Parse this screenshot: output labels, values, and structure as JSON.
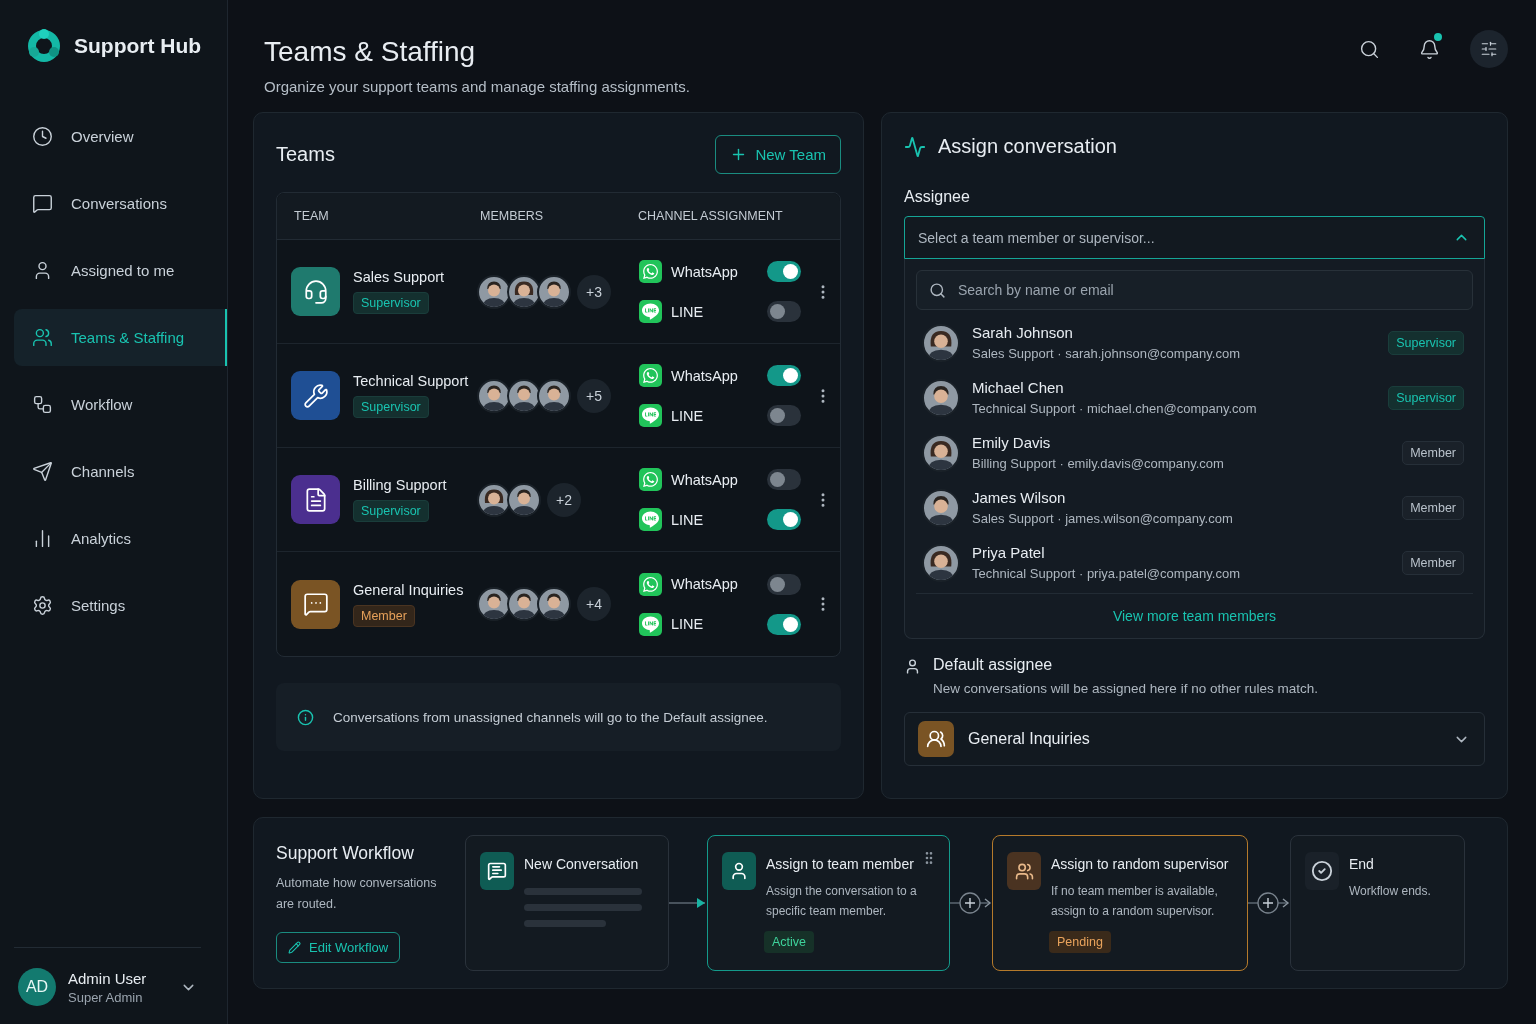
{
  "sidebar": {
    "brand": "Support Hub",
    "nav": [
      {
        "label": "Overview",
        "selected": false
      },
      {
        "label": "Conversations",
        "selected": false
      },
      {
        "label": "Assigned to me",
        "selected": false
      },
      {
        "label": "Teams & Staffing",
        "selected": true
      },
      {
        "label": "Workflow",
        "selected": false
      },
      {
        "label": "Channels",
        "selected": false
      },
      {
        "label": "Analytics",
        "selected": false
      },
      {
        "label": "Settings",
        "selected": false
      }
    ],
    "user": {
      "initials": "AD",
      "name": "Admin User",
      "role": "Super Admin"
    }
  },
  "header": {
    "title": "Teams & Staffing",
    "subtitle": "Organize your support teams and manage staffing assignments.",
    "unread": true
  },
  "teams": {
    "title": "Teams",
    "new_button": "New Team",
    "columns": [
      "TEAM",
      "MEMBERS",
      "CHANNEL ASSIGNMENT"
    ],
    "rows": [
      {
        "name": "Sales Support",
        "role": "Supervisor",
        "kind": "supervisor",
        "color": "#1f7a6e",
        "extra": "+3",
        "channels": [
          {
            "name": "WhatsApp",
            "kind": "whatsapp",
            "on": true
          },
          {
            "name": "LINE",
            "kind": "line",
            "on": false
          }
        ]
      },
      {
        "name": "Technical Support",
        "role": "Supervisor",
        "kind": "supervisor",
        "color": "#1f4f94",
        "extra": "+5",
        "channels": [
          {
            "name": "WhatsApp",
            "kind": "whatsapp",
            "on": true
          },
          {
            "name": "LINE",
            "kind": "line",
            "on": false
          }
        ]
      },
      {
        "name": "Billing Support",
        "role": "Supervisor",
        "kind": "supervisor",
        "color": "#4b2f8f",
        "extra": "+2",
        "channels": [
          {
            "name": "WhatsApp",
            "kind": "whatsapp",
            "on": false
          },
          {
            "name": "LINE",
            "kind": "line",
            "on": true
          }
        ]
      },
      {
        "name": "General Inquiries",
        "role": "Member",
        "kind": "member",
        "color": "#7a5424",
        "extra": "+4",
        "channels": [
          {
            "name": "WhatsApp",
            "kind": "whatsapp",
            "on": false
          },
          {
            "name": "LINE",
            "kind": "line",
            "on": true
          }
        ]
      }
    ],
    "note": "Conversations from unassigned channels will go to the Default assignee."
  },
  "assign": {
    "title": "Assign conversation",
    "label": "Assignee",
    "placeholder": "Select a team member or supervisor...",
    "expanded": true,
    "search_placeholder": "Search by name or email",
    "people": [
      {
        "name": "Sarah Johnson",
        "detail": "Sales Support · sarah.johnson@company.com",
        "role": "Supervisor",
        "kind": "supervisor"
      },
      {
        "name": "Michael Chen",
        "detail": "Technical Support · michael.chen@company.com",
        "role": "Supervisor",
        "kind": "supervisor"
      },
      {
        "name": "Emily Davis",
        "detail": "Billing Support · emily.davis@company.com",
        "role": "Member",
        "kind": "member"
      },
      {
        "name": "James Wilson",
        "detail": "Sales Support · james.wilson@company.com",
        "role": "Member",
        "kind": "member"
      },
      {
        "name": "Priya Patel",
        "detail": "Technical Support · priya.patel@company.com",
        "role": "Member",
        "kind": "member"
      }
    ],
    "more_link": "View more team members",
    "default_title": "Default assignee",
    "default_text": "New conversations will be assigned here if no other rules match.",
    "default_value": "General Inquiries"
  },
  "workflow": {
    "title": "Support Workflow",
    "description": "Automate how conversations are routed.",
    "edit_button": "Edit Workflow",
    "steps": [
      {
        "kind": "start",
        "title": "New Conversation"
      },
      {
        "kind": "active",
        "title": "Assign to team member",
        "description": "Assign the conversation to a specific team member.",
        "status": "Active"
      },
      {
        "kind": "pending",
        "title": "Assign to random supervisor",
        "description": "If no team member is available, assign to a random supervisor.",
        "status": "Pending"
      },
      {
        "kind": "end",
        "title": "End",
        "description": "Workflow ends."
      }
    ]
  }
}
